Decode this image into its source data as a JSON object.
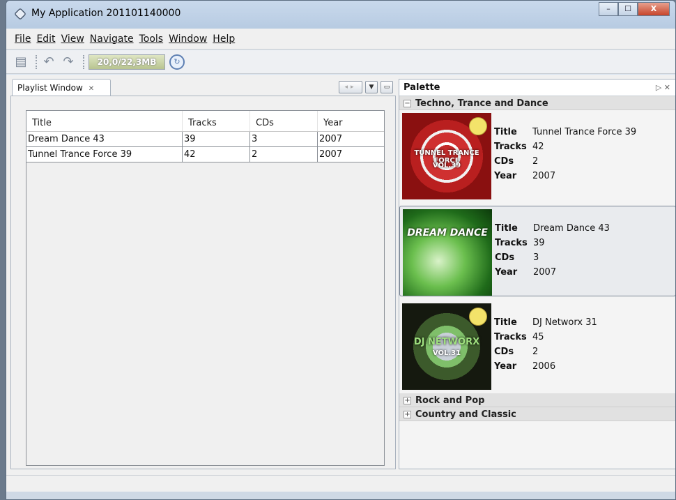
{
  "window": {
    "title": "My Application 201101140000",
    "controls": [
      "–",
      "☐",
      "X"
    ]
  },
  "menu": [
    "File",
    "Edit",
    "View",
    "Navigate",
    "Tools",
    "Window",
    "Help"
  ],
  "toolbar": {
    "memory": "20,0/22,3MB"
  },
  "playlist": {
    "tab_label": "Playlist Window",
    "columns": [
      "Title",
      "Tracks",
      "CDs",
      "Year"
    ],
    "rows": [
      [
        "Dream Dance 43",
        "39",
        "3",
        "2007"
      ],
      [
        "Tunnel Trance Force 39",
        "42",
        "2",
        "2007"
      ]
    ]
  },
  "palette": {
    "title": "Palette",
    "categories": [
      {
        "name": "Techno, Trance and Dance",
        "expanded": true
      },
      {
        "name": "Rock and Pop",
        "expanded": false
      },
      {
        "name": "Country and Classic",
        "expanded": false
      }
    ],
    "labels": {
      "title": "Title",
      "tracks": "Tracks",
      "cds": "CDs",
      "year": "Year"
    },
    "items": [
      {
        "cover_text": "TUNNEL TRANCE FORCE",
        "cover_sub": "VOL.39",
        "title": "Tunnel Trance Force 39",
        "tracks": "42",
        "cds": "2",
        "year": "2007"
      },
      {
        "cover_text": "DREAM DANCE",
        "cover_sub": "",
        "title": "Dream Dance 43",
        "tracks": "39",
        "cds": "3",
        "year": "2007"
      },
      {
        "cover_text": "DJ NETWORX",
        "cover_sub": "VOL.31",
        "title": "DJ Networx 31",
        "tracks": "45",
        "cds": "2",
        "year": "2006"
      }
    ]
  }
}
